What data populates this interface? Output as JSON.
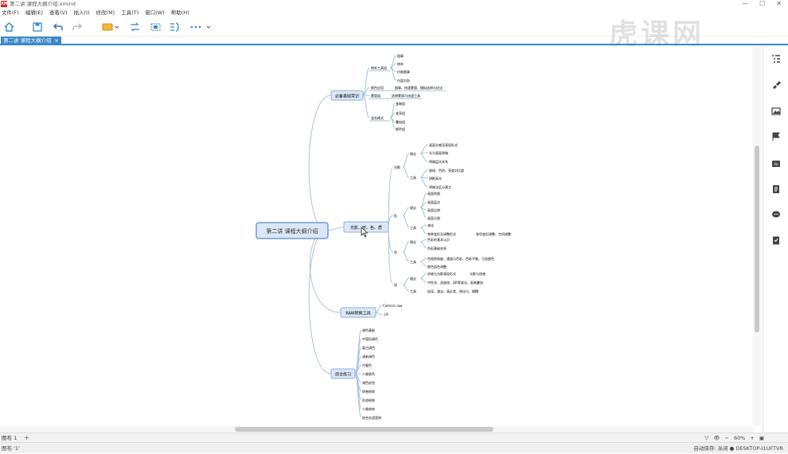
{
  "window": {
    "title": "第二讲 课程大纲介绍.xmind",
    "logo": "XM",
    "controls": [
      "—",
      "☐",
      "✕"
    ]
  },
  "menu": [
    "文件(F)",
    "编辑(E)",
    "查看(V)",
    "插入(I)",
    "修改(M)",
    "工具(T)",
    "窗口(W)",
    "帮助(H)"
  ],
  "toolbar": [
    "home-icon",
    "save-icon",
    "undo-icon",
    "redo-icon",
    "topic-icon",
    "relationship-icon",
    "boundary-icon",
    "summary-icon",
    "more-icon"
  ],
  "tab": {
    "label": "第二讲 课程大纲介绍",
    "close": "✕"
  },
  "watermark": "虎课网",
  "colors": {
    "accent": "#3a88c8",
    "node_fill": "#dbe7f5",
    "node_border": "#8fb1d8",
    "line": "#a9c3e0"
  },
  "mindmap": {
    "central": "第二讲  课程大纲介绍",
    "b1": {
      "label": "必备基础常识",
      "c1": {
        "label": "修补工具组",
        "items": [
          "图章",
          "修补",
          "仿制图章",
          "内容识别"
        ]
      },
      "c2": {
        "label": "颜色应用",
        "text": "图章、快速蒙版、模拟选择与优化"
      },
      "c3": {
        "label": "蒙版组",
        "text": "选择蒙版与快速工具"
      },
      "c4": {
        "label": "混合模式",
        "items": [
          "变暗组",
          "变亮组",
          "叠加组",
          "颜色组"
        ]
      }
    },
    "b2": {
      "label": "光影、形、色、质",
      "g1": {
        "label": "光影",
        "t": {
          "label": "理论",
          "items": [
            "画面光感及表现形式",
            "光与画面明暗",
            "明暗层次关系"
          ]
        },
        "k": {
          "label": "工具",
          "items": [
            "曲线、色阶、亮度对比度",
            "阴影高光",
            "明暗法区分建立"
          ]
        }
      },
      "g2": {
        "label": "形",
        "t": {
          "label": "理论",
          "items": [
            "画面构图",
            "画面层次",
            "画面比例",
            "画面分割"
          ]
        },
        "k": {
          "label": "工具",
          "items": [
            "液化",
            "各种变形及调整形式",
            "各项变形调整、空间调整"
          ]
        }
      },
      "g3": {
        "label": "色",
        "t": {
          "label": "理论",
          "items": [
            "色彩的基本认识",
            "色彩基础关系"
          ]
        },
        "k": {
          "label": "工具",
          "items": [
            "色相饱和度、通道与色彩、色彩平衡、可选颜色",
            "颜色组合调整"
          ]
        }
      },
      "g4": {
        "label": "质",
        "t": {
          "label": "理论",
          "items": [
            "质感与光影表现形式",
            "光影与质感"
          ]
        },
        "k": {
          "label": "工具",
          "text": "加深、减淡、高反差、锐化与、模糊"
        },
        "tools2": "中性灰、双曲线、DR等效法、画笔叠加"
      }
    },
    "b3": {
      "label": "RAW转换工具",
      "items": [
        "Camera raw",
        "LR"
      ]
    },
    "b4": {
      "label": "综合练习",
      "items": [
        "调色基础",
        "中国风调色",
        "复古调色",
        "清新调色",
        "冷暖色",
        "人像肤色",
        "调色综合",
        "质感修饰",
        "形态修饰",
        "人像修饰",
        "综合实战案例"
      ]
    }
  },
  "sheet": {
    "tab": "图布 1",
    "add": "+"
  },
  "zoom": {
    "value": "60%",
    "minus": "−",
    "plus": "+"
  },
  "status": {
    "left": "图布 '1'",
    "right": "自动保存: 关闭   ●  DESKTOP-I1UFTVR"
  }
}
